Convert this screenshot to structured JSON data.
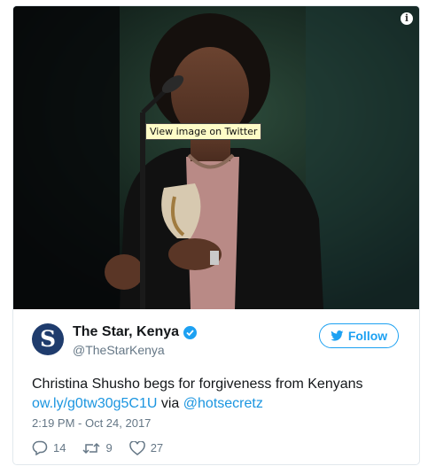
{
  "media": {
    "tooltip": "View image on Twitter",
    "info_icon": "i"
  },
  "tweet": {
    "author_name": "The Star, Kenya",
    "author_handle": "@TheStarKenya",
    "avatar_letter": "S",
    "follow_label": "Follow",
    "text": "Christina Shusho begs for forgiveness from Kenyans",
    "link": "ow.ly/g0tw30g5C1U",
    "via": "via",
    "mention": "@hotsecretz",
    "timestamp": "2:19 PM - Oct 24, 2017"
  },
  "actions": {
    "replies": "14",
    "retweets": "9",
    "likes": "27"
  },
  "colors": {
    "accent": "#1da1f2",
    "link": "#1b95e0",
    "muted": "#657786",
    "avatar_bg": "#1f3c6d"
  }
}
